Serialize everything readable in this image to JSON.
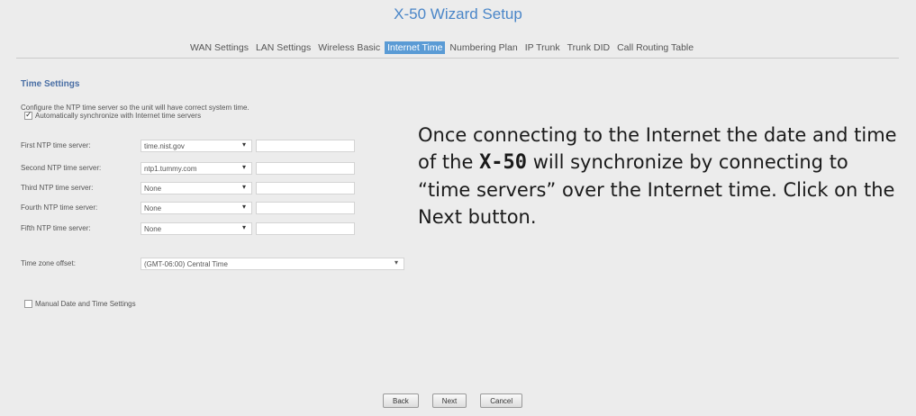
{
  "app": {
    "title": "X-50 Wizard Setup"
  },
  "tabs": [
    {
      "label": "WAN Settings",
      "active": false
    },
    {
      "label": "LAN Settings",
      "active": false
    },
    {
      "label": "Wireless Basic",
      "active": false
    },
    {
      "label": "Internet Time",
      "active": true
    },
    {
      "label": "Numbering Plan",
      "active": false
    },
    {
      "label": "IP Trunk",
      "active": false
    },
    {
      "label": "Trunk DID",
      "active": false
    },
    {
      "label": "Call Routing Table",
      "active": false
    }
  ],
  "section": {
    "title": "Time Settings",
    "description": "Configure the NTP time server so the unit will have correct system time.",
    "auto_sync_label": "Automatically synchronize with Internet time servers",
    "auto_sync_checked": true
  },
  "ntp": [
    {
      "label": "First NTP time server:",
      "value": "time.nist.gov",
      "custom": ""
    },
    {
      "label": "Second NTP time server:",
      "value": "ntp1.tummy.com",
      "custom": ""
    },
    {
      "label": "Third NTP time server:",
      "value": "None",
      "custom": ""
    },
    {
      "label": "Fourth NTP time server:",
      "value": "None",
      "custom": ""
    },
    {
      "label": "Fifth NTP time server:",
      "value": "None",
      "custom": ""
    }
  ],
  "timezone": {
    "label": "Time zone offset:",
    "value": "(GMT-06:00) Central Time"
  },
  "manual": {
    "label": "Manual Date and Time Settings",
    "checked": false
  },
  "buttons": {
    "back": "Back",
    "next": "Next",
    "cancel": "Cancel"
  },
  "caption": {
    "part1": "Once connecting to the Internet the date and time of the ",
    "product": "X-50",
    "part2": " will synchronize by connecting to “time servers” over the Internet time. Click on the Next button."
  },
  "colors": {
    "accent": "#5a9bd5",
    "title": "#4a86c8",
    "section": "#4a6fa5"
  }
}
